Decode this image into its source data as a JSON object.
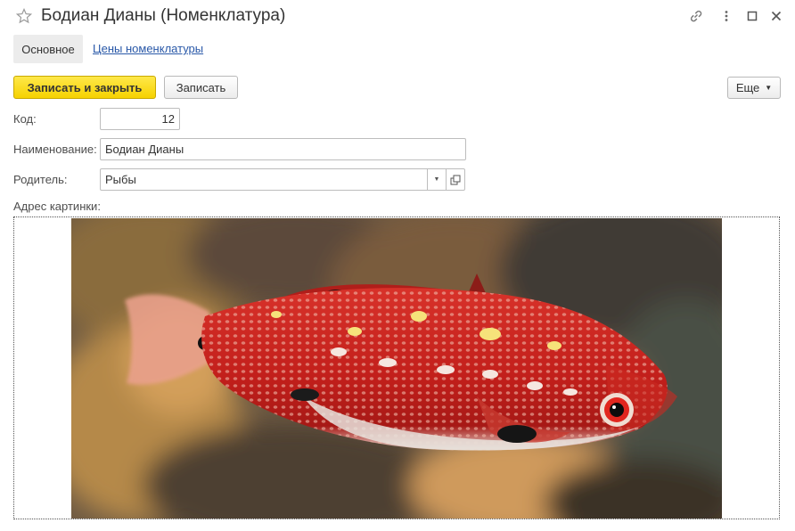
{
  "window": {
    "title": "Бодиан Дианы (Номенклатура)"
  },
  "tabs": [
    {
      "label": "Основное",
      "active": true
    },
    {
      "label": "Цены номенклатуры",
      "active": false
    }
  ],
  "toolbar": {
    "save_close_label": "Записать и закрыть",
    "save_label": "Записать",
    "more_label": "Еще"
  },
  "form": {
    "code_label": "Код:",
    "code_value": "12",
    "name_label": "Наименование:",
    "name_value": "Бодиан Дианы",
    "parent_label": "Родитель:",
    "parent_value": "Рыбы",
    "picture_label": "Адрес картинки:"
  },
  "icons": {
    "favorite": "star-icon",
    "link": "link-icon",
    "more": "more-vertical-icon",
    "maximize": "maximize-icon",
    "close": "close-icon",
    "dropdown": "chevron-down-icon",
    "open": "open-icon"
  },
  "colors": {
    "primary_button": "#f6d200",
    "link": "#2958a8",
    "fish_body": "#c8231e"
  }
}
